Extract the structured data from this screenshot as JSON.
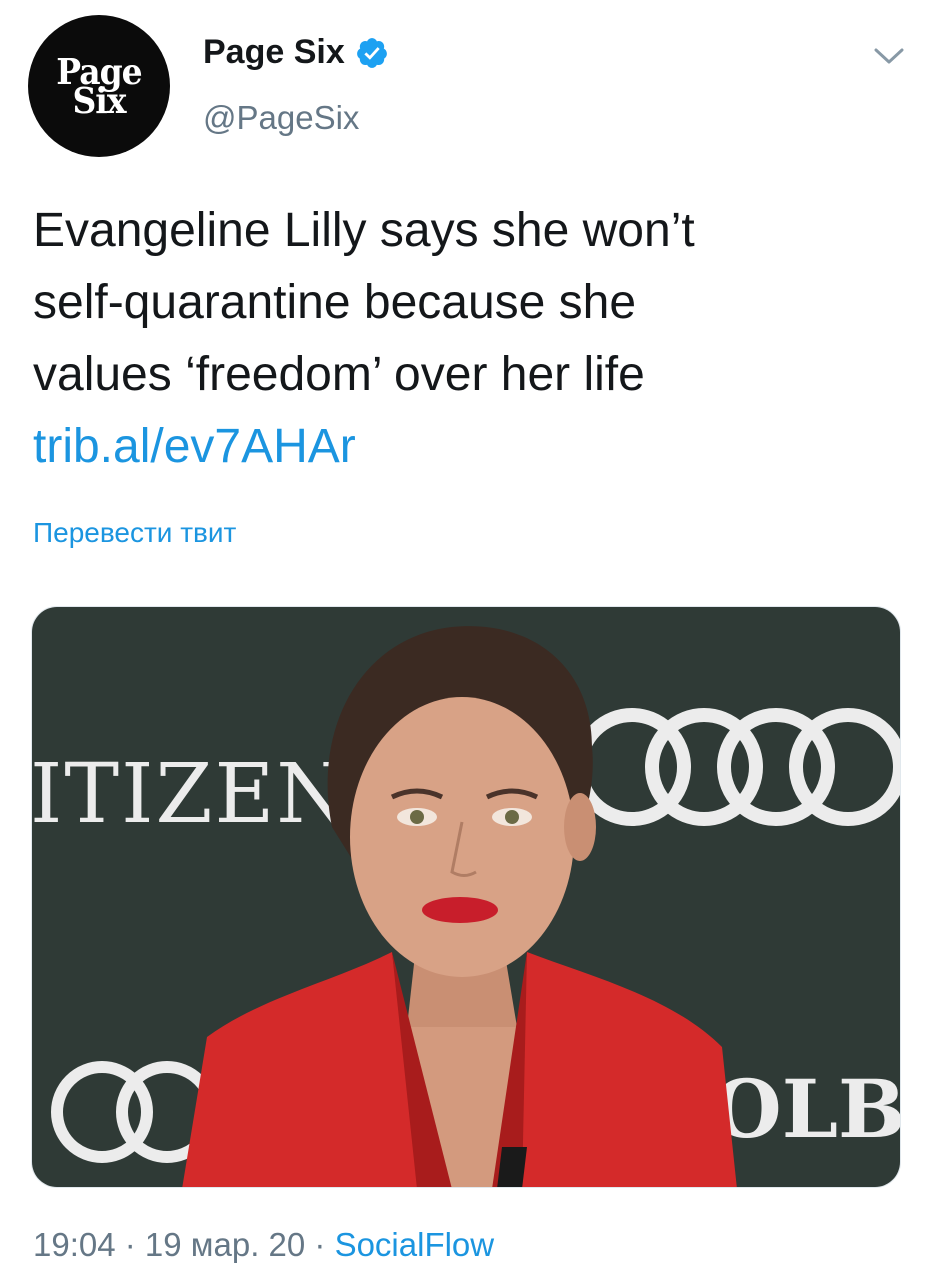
{
  "account": {
    "avatar_line1": "Page",
    "avatar_line2": "Six",
    "display_name": "Page Six",
    "handle": "@PageSix",
    "verified_icon": "verified-badge-icon",
    "menu_icon": "chevron-down-icon"
  },
  "tweet": {
    "text_lines": [
      "Evangeline Lilly says she won’t",
      "self-quarantine because she",
      "values ‘freedom’ over her life"
    ],
    "link": "trib.al/ev7AHAr",
    "translate_label": "Перевести твит"
  },
  "media": {
    "sign_left": "ITIZEN",
    "sign_bottom_right": "OLB",
    "background_color": "#2f3a36",
    "jacket_color": "#d42a2a",
    "lip_color": "#c81e2b"
  },
  "meta": {
    "time": "19:04",
    "separator": " · ",
    "date": "19 мар. 20",
    "source": "SocialFlow"
  },
  "colors": {
    "link": "#1b95e0",
    "secondary_text": "#657786",
    "primary_text": "#14171a"
  }
}
